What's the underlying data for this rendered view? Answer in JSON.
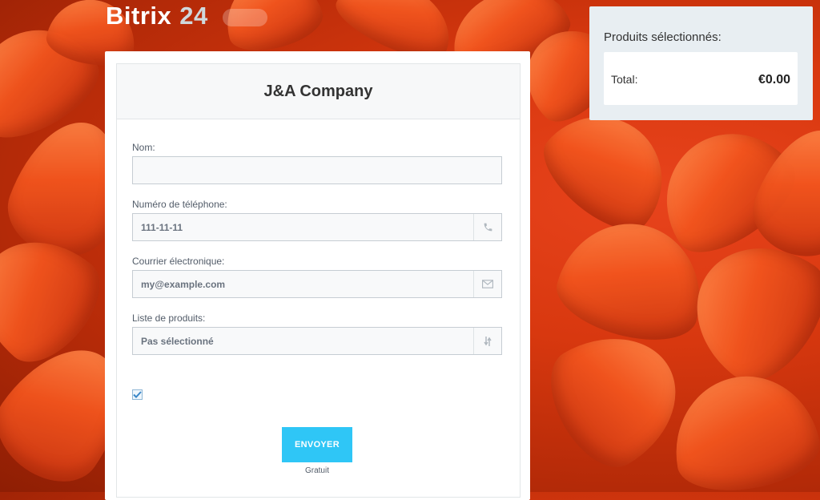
{
  "logo": {
    "brand": "Bitrix",
    "number": "24"
  },
  "form": {
    "title": "J&A Company",
    "fields": [
      {
        "label": "Nom:",
        "value": "",
        "icon": null
      },
      {
        "label": "Numéro de téléphone:",
        "value": "111-11-11",
        "icon": "phone-icon"
      },
      {
        "label": "Courrier électronique:",
        "value": "my@example.com",
        "icon": "envelope-icon"
      },
      {
        "label": "Liste de produits:",
        "value": "Pas sélectionné",
        "icon": "sort-arrows-icon"
      }
    ],
    "checkbox_checked": true,
    "submit_label": "ENVOYER",
    "submit_sublabel": "Gratuit"
  },
  "cart": {
    "title": "Produits sélectionnés:",
    "total_label": "Total:",
    "total_value": "€0.00"
  },
  "colors": {
    "accent": "#2fc6f6",
    "background": "#e0441a",
    "card": "#ffffff",
    "cart_panel": "#e8eef2"
  }
}
